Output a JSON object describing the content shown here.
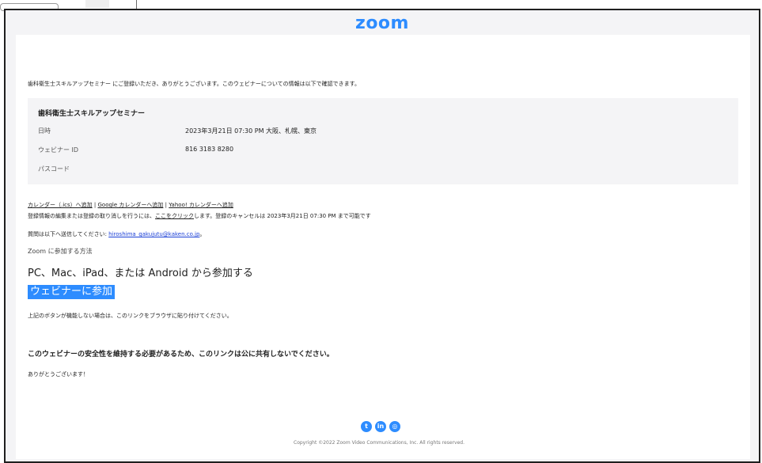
{
  "brand": {
    "logo": "zoom",
    "accent": "#2d8cff"
  },
  "intro": "歯科衛生士スキルアップセミナー にご登録いただき、ありがとうございます。このウェビナーについての情報は以下で確認できます。",
  "info": {
    "title": "歯科衛生士スキルアップセミナー",
    "rows": [
      {
        "label": "日時",
        "value": "2023年3月21日 07:30 PM 大阪、札幌、東京"
      },
      {
        "label": "ウェビナー ID",
        "value": "816 3183 8280"
      },
      {
        "label": "パスコード",
        "value": ""
      }
    ]
  },
  "calendar": {
    "ics": "カレンダー（.ics）へ追加",
    "sep": "|",
    "google": "Google カレンダーへ追加",
    "yahoo": "Yahoo! カレンダーへ追加"
  },
  "cancel": {
    "pre": "登録情報の編集または登録の取り消しを行うには、",
    "link": "ここをクリック",
    "post": "します。登録のキャンセルは 2023年3月21日 07:30 PM まで可能です"
  },
  "contact": {
    "pre": "質問は以下へ送信してください: ",
    "email": "hiroshima_gakujutu@kaken.co.jp",
    "post": "。"
  },
  "howto": "Zoom に参加する方法",
  "devices_heading": "PC、Mac、iPad、または Android から参加する",
  "join_button": "ウェビナーに参加",
  "fallback": "上記のボタンが機能しない場合は、このリンクをブラウザに貼り付けてください。",
  "security_note": "このウェビナーの安全性を維持する必要があるため、このリンクは公に共有しないでください。",
  "thanks": "ありがとうございます！",
  "social_icons": [
    "twitter-icon",
    "linkedin-icon",
    "rss-icon"
  ],
  "footer": "Copyright ©2022 Zoom Video Communications, Inc. All rights reserved."
}
